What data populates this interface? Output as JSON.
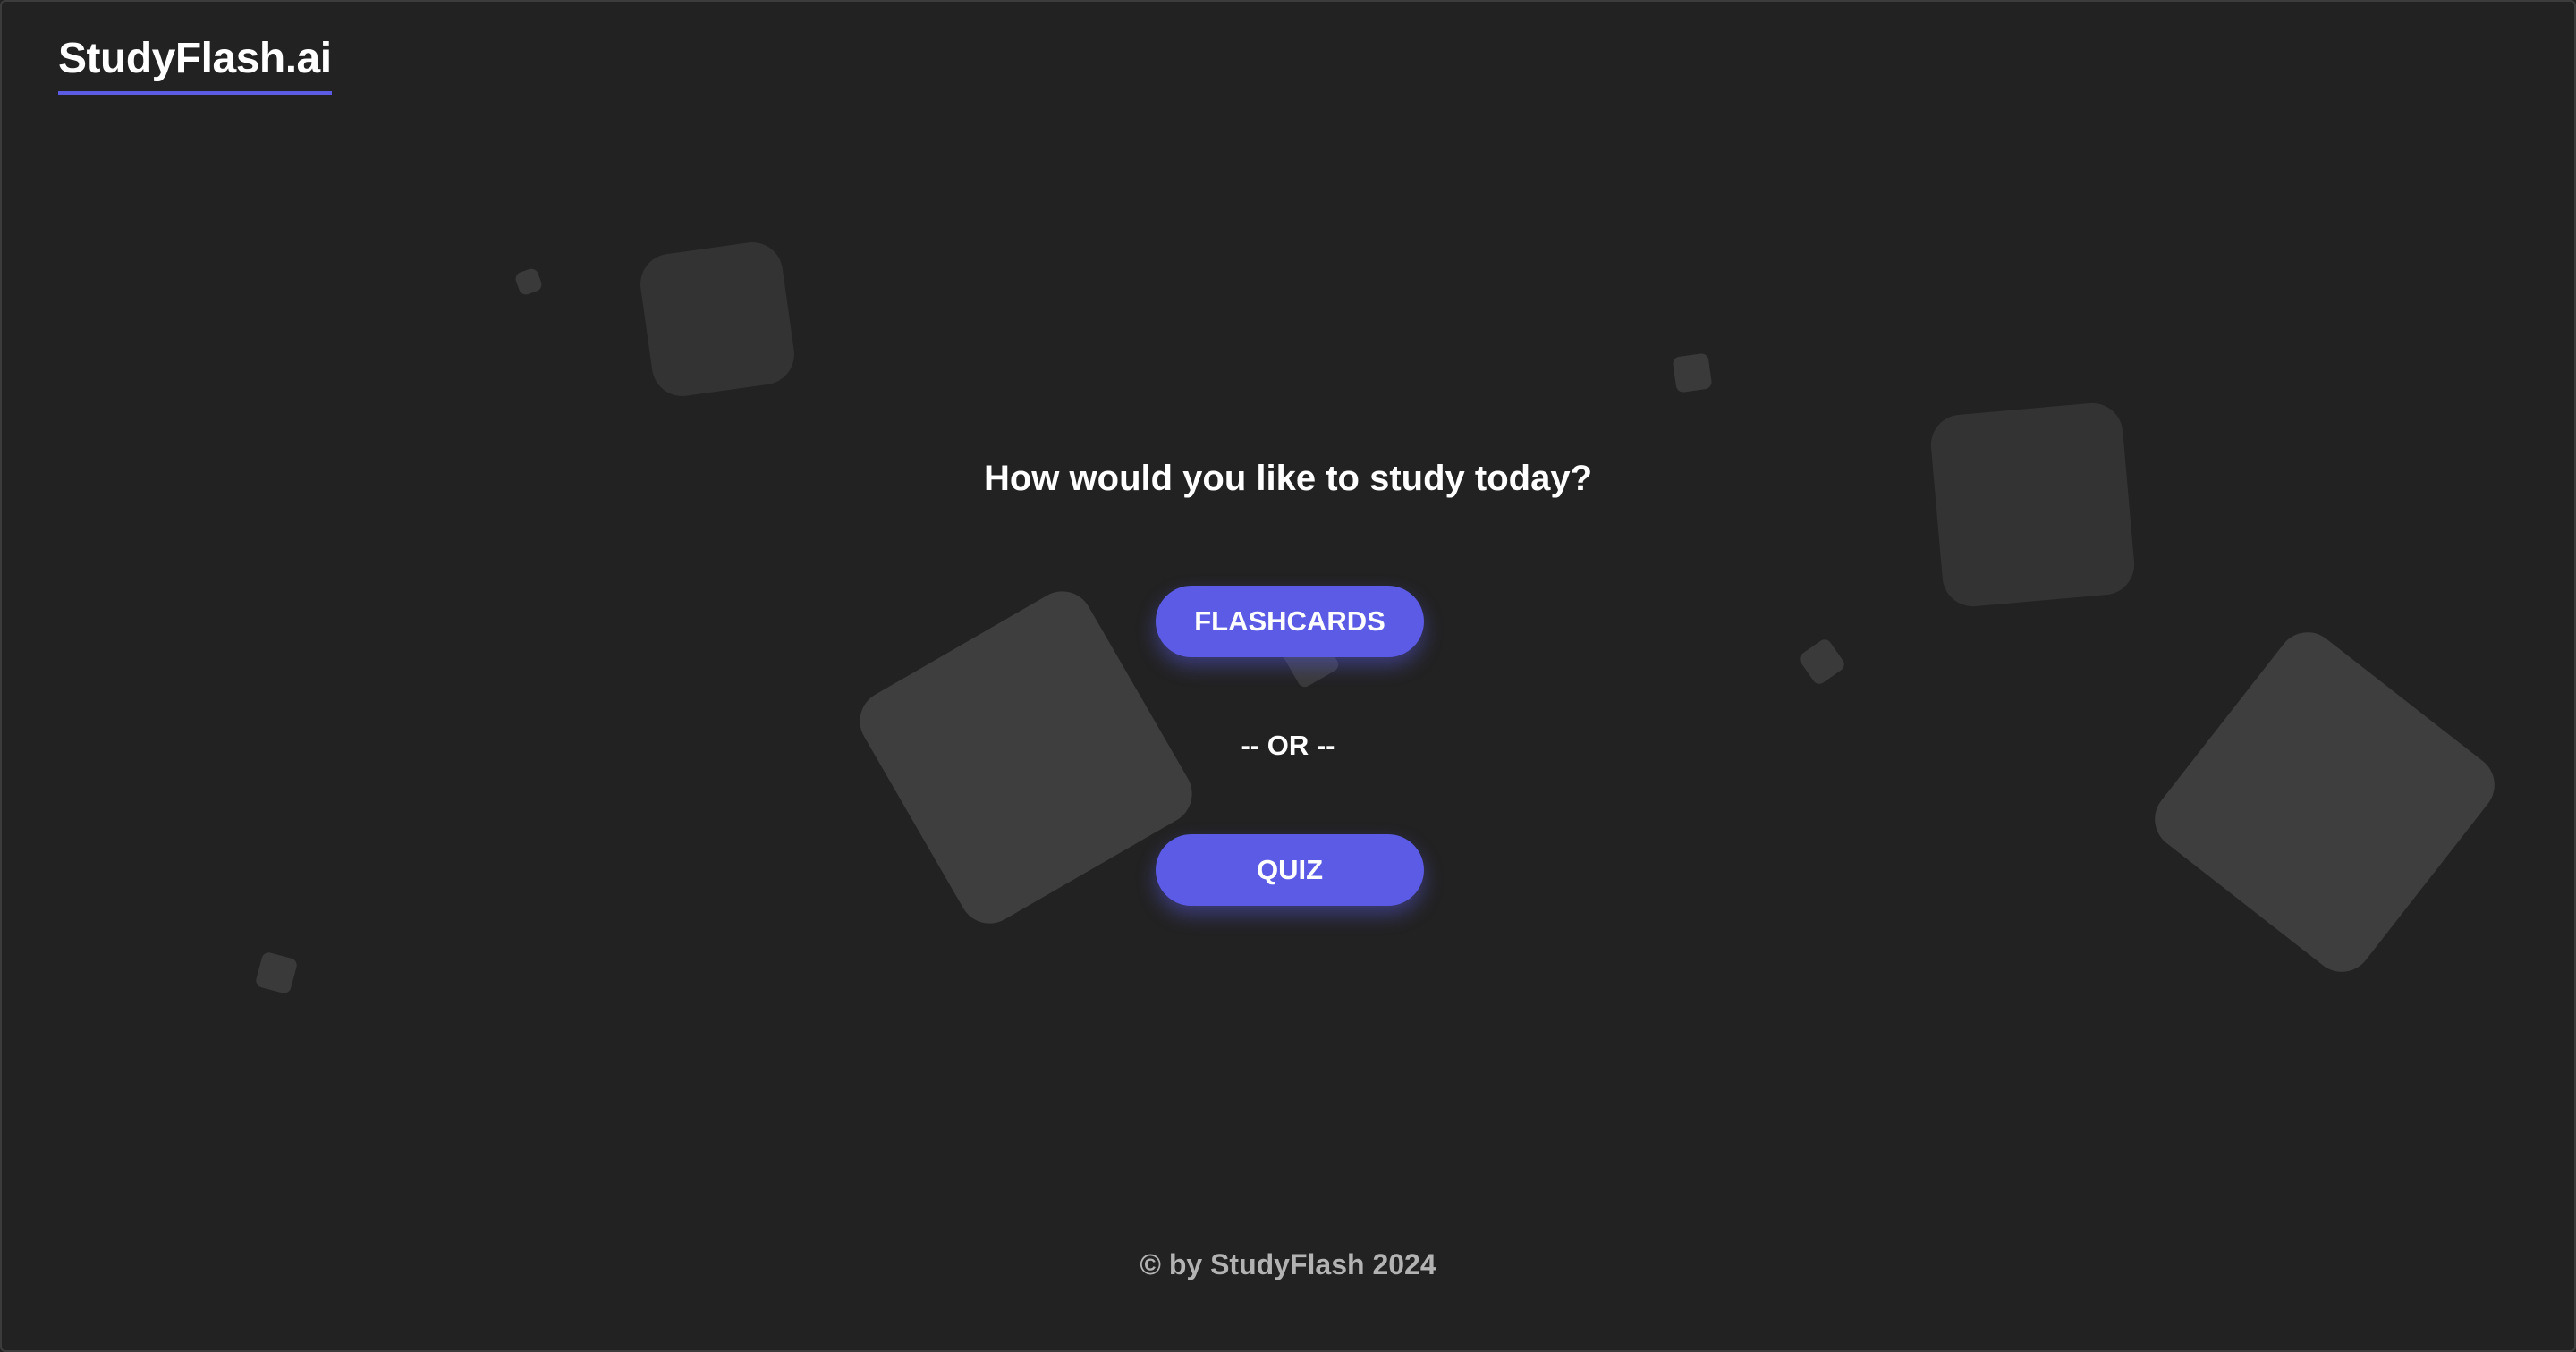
{
  "header": {
    "logo_text": "StudyFlash.ai"
  },
  "main": {
    "headline": "How would you like to study today?",
    "flashcards_label": "FLASHCARDS",
    "separator": "-- OR --",
    "quiz_label": "QUIZ"
  },
  "footer": {
    "copyright": "© by StudyFlash 2024"
  },
  "colors": {
    "background": "#222222",
    "accent": "#5b5be6",
    "shape": "#3e3e3e",
    "footer_text": "#b3b3b3"
  }
}
